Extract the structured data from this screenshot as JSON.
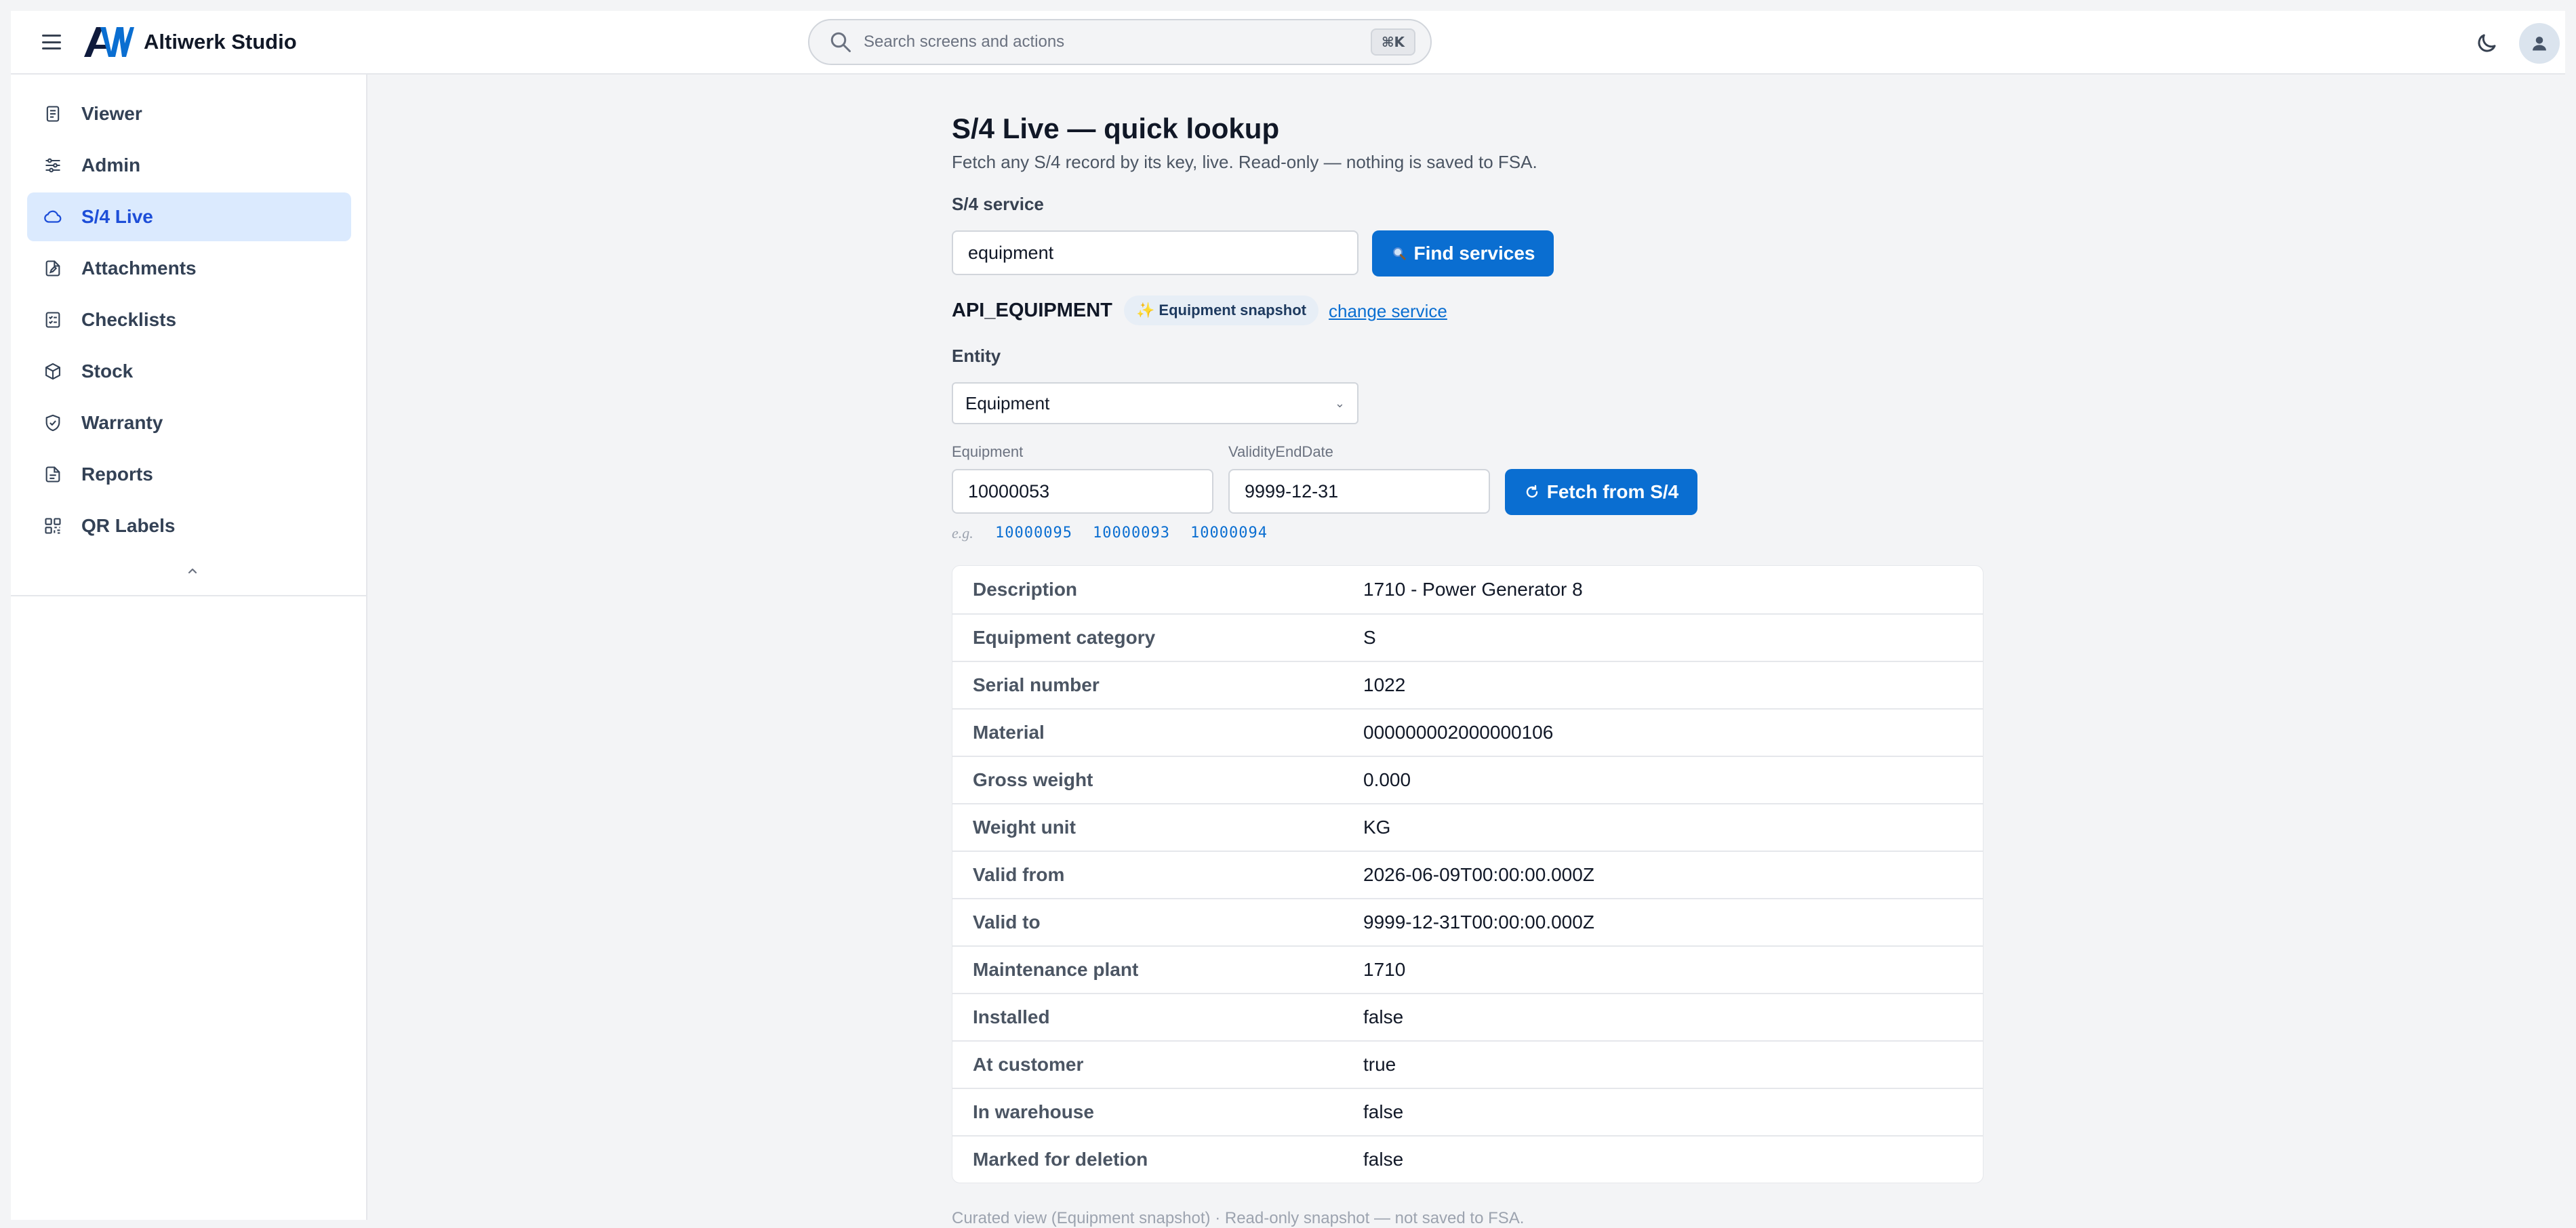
{
  "app": {
    "title": "Altiwerk Studio"
  },
  "search": {
    "placeholder": "Search screens and actions",
    "shortcut": "⌘K"
  },
  "sidebar": {
    "items": [
      {
        "label": "Viewer",
        "icon": "document-icon",
        "active": false
      },
      {
        "label": "Admin",
        "icon": "sliders-icon",
        "active": false
      },
      {
        "label": "S/4 Live",
        "icon": "cloud-icon",
        "active": true
      },
      {
        "label": "Attachments",
        "icon": "file-edit-icon",
        "active": false
      },
      {
        "label": "Checklists",
        "icon": "checklist-icon",
        "active": false
      },
      {
        "label": "Stock",
        "icon": "box-icon",
        "active": false
      },
      {
        "label": "Warranty",
        "icon": "shield-check-icon",
        "active": false
      },
      {
        "label": "Reports",
        "icon": "report-icon",
        "active": false
      },
      {
        "label": "QR Labels",
        "icon": "qr-icon",
        "active": false
      }
    ]
  },
  "main": {
    "title": "S/4 Live — quick lookup",
    "subtitle": "Fetch any S/4 record by its key, live. Read-only — nothing is saved to FSA.",
    "service_label": "S/4 service",
    "service_value": "equipment",
    "find_button": "Find services",
    "service_name": "API_EQUIPMENT",
    "service_badge": "Equipment snapshot",
    "change_link": "change service",
    "entity_label": "Entity",
    "entity_value": "Equipment",
    "key_fields": [
      {
        "label": "Equipment",
        "value": "10000053"
      },
      {
        "label": "ValidityEndDate",
        "value": "9999-12-31"
      }
    ],
    "fetch_button": "Fetch from S/4",
    "examples_label": "e.g.",
    "examples": [
      "10000095",
      "10000093",
      "10000094"
    ],
    "result_rows": [
      {
        "key": "Description",
        "value": "1710 - Power Generator 8"
      },
      {
        "key": "Equipment category",
        "value": "S"
      },
      {
        "key": "Serial number",
        "value": "1022"
      },
      {
        "key": "Material",
        "value": "000000002000000106"
      },
      {
        "key": "Gross weight",
        "value": "0.000"
      },
      {
        "key": "Weight unit",
        "value": "KG"
      },
      {
        "key": "Valid from",
        "value": "2026-06-09T00:00:00.000Z"
      },
      {
        "key": "Valid to",
        "value": "9999-12-31T00:00:00.000Z"
      },
      {
        "key": "Maintenance plant",
        "value": "1710"
      },
      {
        "key": "Installed",
        "value": "false"
      },
      {
        "key": "At customer",
        "value": "true"
      },
      {
        "key": "In warehouse",
        "value": "false"
      },
      {
        "key": "Marked for deletion",
        "value": "false"
      }
    ],
    "footnote": "Curated view (Equipment snapshot) · Read-only snapshot — not saved to FSA."
  },
  "colors": {
    "accent": "#0a6ed1",
    "active_bg": "#dbeafe",
    "page_bg": "#f3f4f6"
  }
}
